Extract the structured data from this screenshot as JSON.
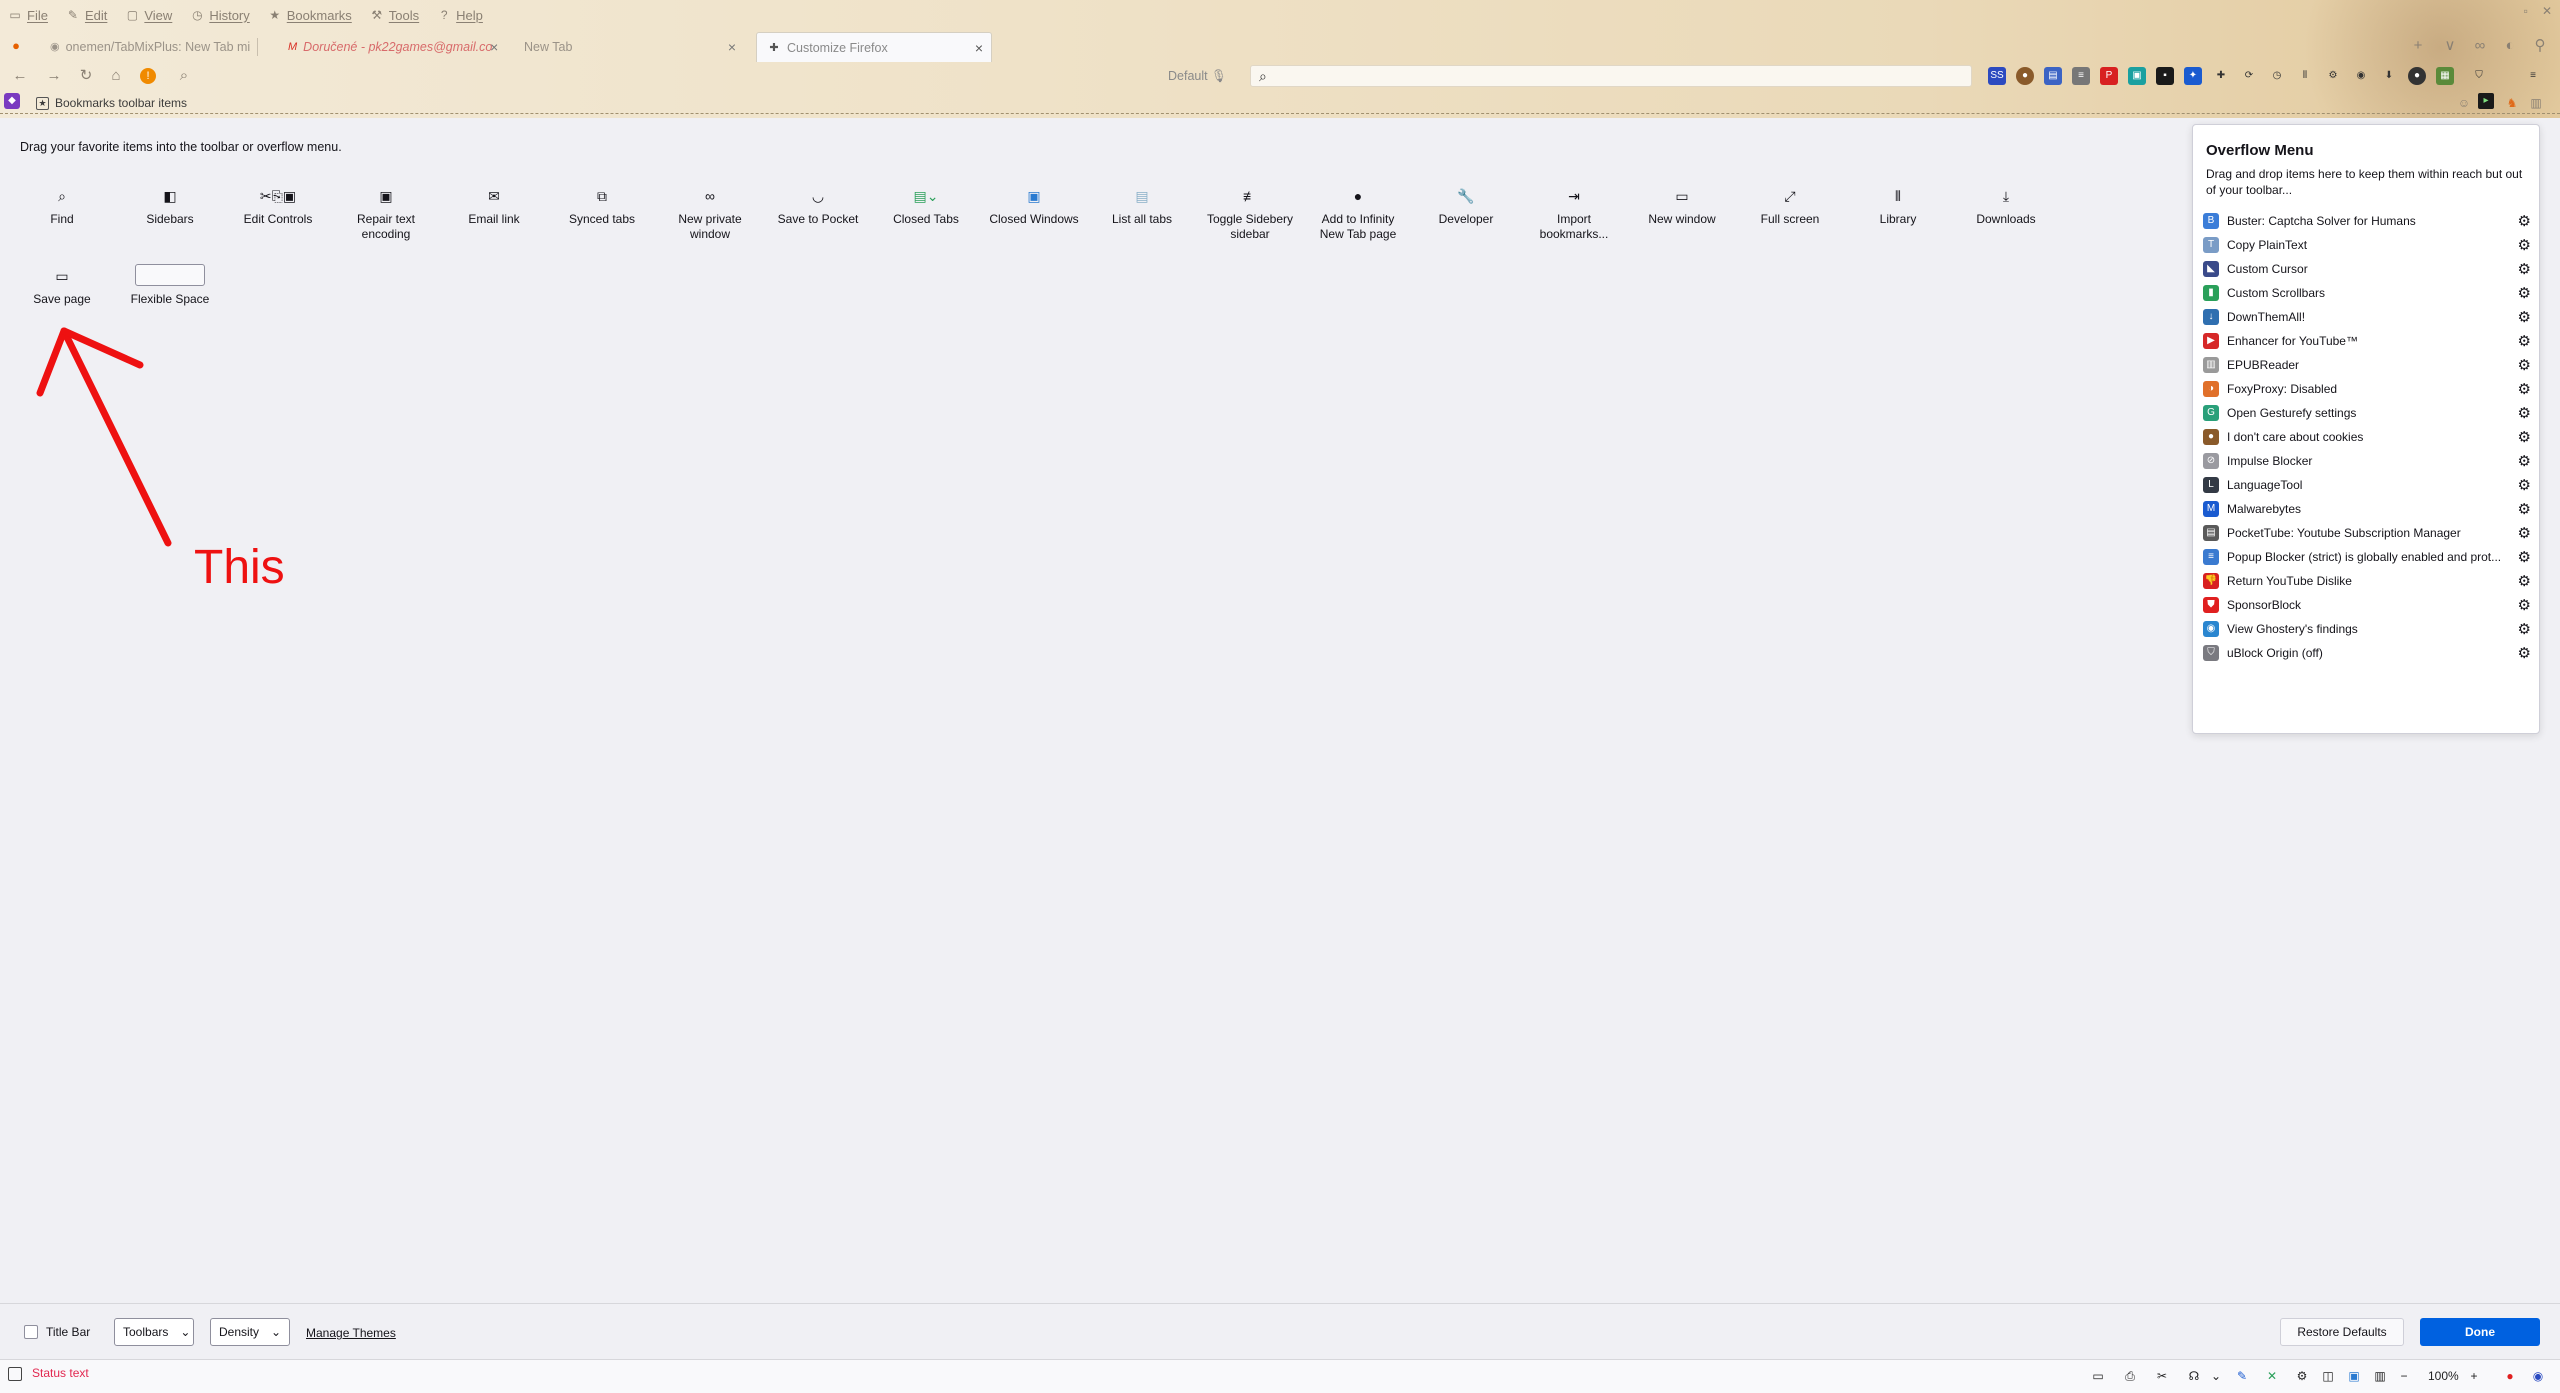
{
  "menubar": {
    "items": [
      {
        "icon": "file-icon",
        "label": "File"
      },
      {
        "icon": "edit-icon",
        "label": "Edit"
      },
      {
        "icon": "view-icon",
        "label": "View"
      },
      {
        "icon": "history-icon",
        "label": "History"
      },
      {
        "icon": "star-icon",
        "label": "Bookmarks"
      },
      {
        "icon": "tools-icon",
        "label": "Tools"
      },
      {
        "icon": "help-icon",
        "label": "Help"
      }
    ]
  },
  "tabs": [
    {
      "label": "onemen/TabMixPlus: New Tab mi",
      "icon": "github-icon"
    },
    {
      "label": "Doručené - pk22games@gmail.co",
      "icon": "gmail-icon"
    },
    {
      "label": "New Tab",
      "icon": ""
    },
    {
      "label": "Customize Firefox",
      "icon": "puzzle-icon",
      "close": "×"
    }
  ],
  "navbar": {
    "default_label": "Default",
    "search_placeholder": ""
  },
  "bookmarks": {
    "item_label": "Bookmarks toolbar items"
  },
  "customize": {
    "instructions": "Drag your favorite items into the toolbar or overflow menu.",
    "palette": [
      {
        "label": "Find",
        "icon": "search-icon"
      },
      {
        "label": "Sidebars",
        "icon": "sidebar-icon"
      },
      {
        "label": "Edit Controls",
        "icon": "cut-copy-paste-icon"
      },
      {
        "label": "Repair text encoding",
        "icon": "text-encoding-icon"
      },
      {
        "label": "Email link",
        "icon": "email-icon"
      },
      {
        "label": "Synced tabs",
        "icon": "synced-tabs-icon"
      },
      {
        "label": "New private window",
        "icon": "private-mask-icon"
      },
      {
        "label": "Save to Pocket",
        "icon": "pocket-icon"
      },
      {
        "label": "Closed Tabs",
        "icon": "closed-tabs-icon"
      },
      {
        "label": "Closed Windows",
        "icon": "closed-windows-icon"
      },
      {
        "label": "List all tabs",
        "icon": "list-tabs-icon"
      },
      {
        "label": "Toggle Sidebery sidebar",
        "icon": "sidebery-icon"
      },
      {
        "label": "Add to Infinity New Tab page",
        "icon": "infinity-icon"
      },
      {
        "label": "Developer",
        "icon": "wrench-icon"
      },
      {
        "label": "Import bookmarks...",
        "icon": "import-icon"
      },
      {
        "label": "New window",
        "icon": "new-window-icon"
      },
      {
        "label": "Full screen",
        "icon": "fullscreen-icon"
      },
      {
        "label": "Library",
        "icon": "library-icon"
      },
      {
        "label": "Downloads",
        "icon": "download-icon"
      },
      {
        "label": "Save page",
        "icon": "save-page-icon"
      },
      {
        "label": "Flexible Space",
        "icon": "flexible-space-icon"
      }
    ]
  },
  "overflow": {
    "title": "Overflow Menu",
    "description": "Drag and drop items here to keep them within reach but out of your toolbar...",
    "items": [
      {
        "label": "Buster: Captcha Solver for Humans",
        "color": "#3b7dd8"
      },
      {
        "label": "Copy PlainText",
        "color": "#7a9cc6"
      },
      {
        "label": "Custom Cursor",
        "color": "#3a4a8a"
      },
      {
        "label": "Custom Scrollbars",
        "color": "#2aa05a"
      },
      {
        "label": "DownThemAll!",
        "color": "#2f6fb0"
      },
      {
        "label": "Enhancer for YouTube™",
        "color": "#d62828"
      },
      {
        "label": "EPUBReader",
        "color": "#9a9a9a"
      },
      {
        "label": "FoxyProxy: Disabled",
        "color": "#e0702a"
      },
      {
        "label": "Open Gesturefy settings",
        "color": "#2aa07a"
      },
      {
        "label": "I don't care about cookies",
        "color": "#8a5a2a"
      },
      {
        "label": "Impulse Blocker",
        "color": "#9a9aa0"
      },
      {
        "label": "LanguageTool",
        "color": "#333a45"
      },
      {
        "label": "Malwarebytes",
        "color": "#1a5bd0"
      },
      {
        "label": "PocketTube: Youtube Subscription Manager",
        "color": "#5a5a5a"
      },
      {
        "label": "Popup Blocker (strict) is globally enabled and prot...",
        "color": "#3a7ad0"
      },
      {
        "label": "Return YouTube Dislike",
        "color": "#d82020"
      },
      {
        "label": "SponsorBlock",
        "color": "#e02020"
      },
      {
        "label": "View Ghostery's findings",
        "color": "#2a86d0"
      },
      {
        "label": "uBlock Origin (off)",
        "color": "#7a7a80"
      }
    ]
  },
  "annotation": {
    "text": "This",
    "color": "#ee1111"
  },
  "footer": {
    "title_bar_label": "Title Bar",
    "toolbars_label": "Toolbars",
    "density_label": "Density",
    "manage_themes_label": "Manage Themes",
    "restore_defaults_label": "Restore Defaults",
    "done_label": "Done"
  },
  "statusbar": {
    "status_text": "Status text",
    "zoom": "100%"
  },
  "colors": {
    "accent": "#0061e0",
    "annotation": "#ee1111",
    "status_text": "#e22850"
  }
}
